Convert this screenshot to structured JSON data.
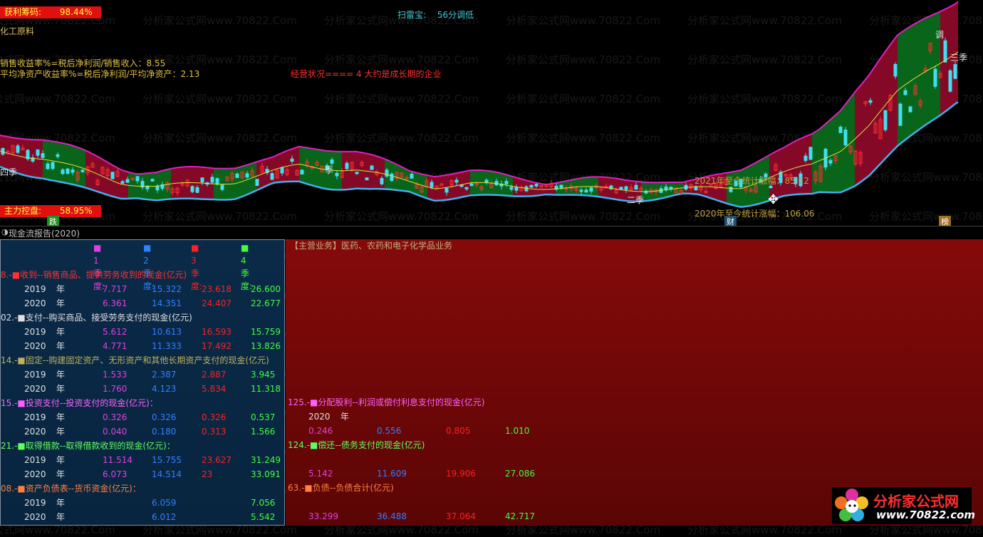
{
  "indicators": {
    "profit_chip_label": "获利筹码:",
    "profit_chip_value": "98.44%",
    "main_control_label": "主力控盘:",
    "main_control_value": "58.95%",
    "category": "化工原料",
    "sales_margin_label": "销售收益率%=税后净利润/销售收入：",
    "sales_margin_value": "8.55",
    "roe_label": "平均净资产收益率%=税后净利润/平均净资产：",
    "roe_value": "2.13",
    "scan_label": "扫雷宝:",
    "scan_value": "56分调低",
    "operation_status": "经营状况==== 4 大约是成长期的企业",
    "stat_2021": "2021年至今统计涨幅：85.12",
    "stat_2020": "2020年至今统计涨幅：106.06",
    "marker_q4": "四季",
    "marker_q2_mid": "二季",
    "marker_q3_top": "三季",
    "marker_q3_left": "季",
    "marker_tiao": "调",
    "marker_die": "跌",
    "marker_cai": "财",
    "marker_bang": "榜"
  },
  "panel": {
    "title": "现金流报告(2020)",
    "quarters": [
      "1季度:",
      "2季度:",
      "3季度:",
      "4季度:"
    ],
    "main_business_label": "【主营业务】",
    "main_business_value": "医药、农药和电子化学品业务",
    "sections_left": [
      {
        "header": "8.-■收到--销售商品、提供劳务收到的现金(亿元)",
        "rows": [
          {
            "year": "2019",
            "unit": "年",
            "q": [
              "7.717",
              "15.322",
              "23.618",
              "26.600"
            ]
          },
          {
            "year": "2020",
            "unit": "年",
            "q": [
              "6.361",
              "14.351",
              "24.407",
              "22.677"
            ]
          }
        ]
      },
      {
        "header": "02.-■支付--购买商品、接受劳务支付的现金(亿元)",
        "rows": [
          {
            "year": "2019",
            "unit": "年",
            "q": [
              "5.612",
              "10.613",
              "16.593",
              "15.759"
            ]
          },
          {
            "year": "2020",
            "unit": "年",
            "q": [
              "4.771",
              "11.333",
              "17.492",
              "13.826"
            ]
          }
        ]
      },
      {
        "header": "14.-■固定--购建固定资产、无形资产和其他长期资产支付的现金(亿元)",
        "rows": [
          {
            "year": "2019",
            "unit": "年",
            "q": [
              "1.533",
              "2.387",
              "2.887",
              "3.945"
            ]
          },
          {
            "year": "2020",
            "unit": "年",
            "q": [
              "1.760",
              "4.123",
              "5.834",
              "11.318"
            ]
          }
        ]
      },
      {
        "header": "15.-■投资支付--投资支付的现金(亿元)：",
        "rows": [
          {
            "year": "2019",
            "unit": "年",
            "q": [
              "0.326",
              "0.326",
              "0.326",
              "0.537"
            ]
          },
          {
            "year": "2020",
            "unit": "年",
            "q": [
              "0.040",
              "0.180",
              "0.313",
              "1.566"
            ]
          }
        ]
      },
      {
        "header": "21.-■取得借款--取得借款收到的现金(亿元)：",
        "rows": [
          {
            "year": "2019",
            "unit": "年",
            "q": [
              "11.514",
              "15.755",
              "23.627",
              "31.249"
            ]
          },
          {
            "year": "2020",
            "unit": "年",
            "q": [
              "6.073",
              "14.514",
              "23",
              "33.091"
            ]
          }
        ]
      },
      {
        "header": "08.-■资产负债表--货币资金(亿元)：",
        "rows": [
          {
            "year": "2019",
            "unit": "年",
            "q": [
              "",
              "6.059",
              "",
              "7.056"
            ]
          },
          {
            "year": "2020",
            "unit": "年",
            "q": [
              "",
              "6.012",
              "",
              "5.542"
            ]
          }
        ]
      }
    ],
    "sections_right": [
      {
        "header": "125.-■分配股利--利润或偿付利息支付的现金(亿元)",
        "year": "2020",
        "unit": "年",
        "q": [
          "0.246",
          "0.556",
          "0.805",
          "1.010"
        ]
      },
      {
        "header": "124.-■偿还--债务支付的现金(亿元)",
        "q": [
          "5.142",
          "11.609",
          "19.906",
          "27.086"
        ]
      },
      {
        "header": "63.-■负债--负债合计(亿元)",
        "q": [
          "33.299",
          "36.488",
          "37.064",
          "42.717"
        ]
      }
    ]
  },
  "logo": {
    "name": "分析家公式网",
    "url": "www.70822.com"
  },
  "watermark": "分析家公式网www.70822.Com",
  "colors": {
    "up": "#ff3030",
    "down": "#40e0f0",
    "band_up": "#8a0a28",
    "band_down": "#0a6a1a",
    "band_line_top": "#e020c0",
    "band_line_bottom": "#40b0f0",
    "ma": "#e0e040"
  }
}
